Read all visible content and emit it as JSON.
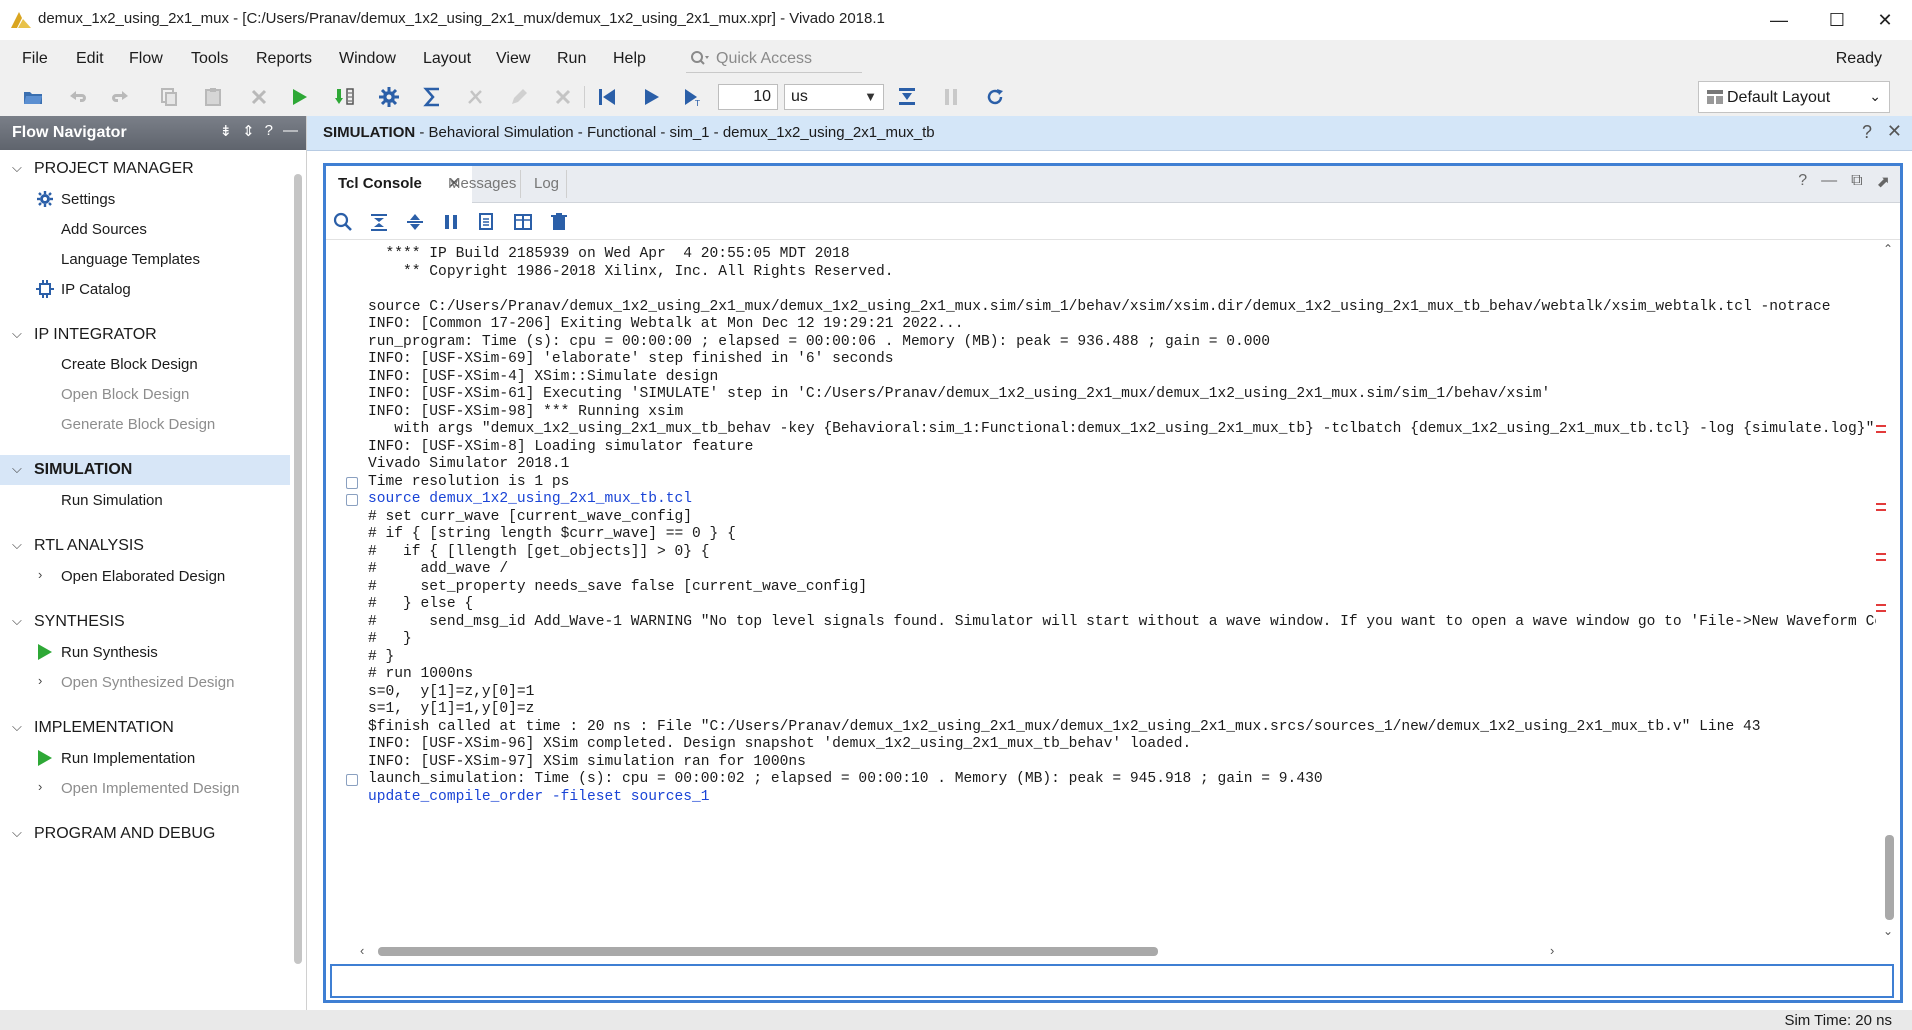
{
  "window": {
    "title": "demux_1x2_using_2x1_mux - [C:/Users/Pranav/demux_1x2_using_2x1_mux/demux_1x2_using_2x1_mux.xpr] - Vivado 2018.1",
    "minimize": "—",
    "maximize": "☐",
    "close": "✕"
  },
  "menu": {
    "items": [
      "File",
      "Edit",
      "Flow",
      "Tools",
      "Reports",
      "Window",
      "Layout",
      "View",
      "Run",
      "Help"
    ],
    "quick_access": "Quick Access",
    "status": "Ready"
  },
  "toolbar": {
    "run_time_value": "10",
    "run_time_unit": "us",
    "layout": "Default Layout",
    "icons": [
      "open-project-icon",
      "undo-icon",
      "redo-icon",
      "copy-icon",
      "paste-icon",
      "delete-icon",
      "run-icon",
      "run-all-icon",
      "settings-icon",
      "sigma-icon",
      "cut-icon",
      "edit-icon",
      "cancel-icon",
      "restart-icon",
      "run-all-sim-icon",
      "run-for-icon",
      "step-icon",
      "break-icon",
      "relaunch-icon"
    ]
  },
  "flow_navigator": {
    "title": "Flow Navigator",
    "sections": [
      {
        "label": "PROJECT MANAGER",
        "items": [
          {
            "label": "Settings",
            "icon": "gear-icon",
            "enabled": true
          },
          {
            "label": "Add Sources",
            "enabled": true
          },
          {
            "label": "Language Templates",
            "enabled": true
          },
          {
            "label": "IP Catalog",
            "icon": "ip-catalog-icon",
            "enabled": true
          }
        ]
      },
      {
        "label": "IP INTEGRATOR",
        "items": [
          {
            "label": "Create Block Design",
            "enabled": true
          },
          {
            "label": "Open Block Design",
            "enabled": false
          },
          {
            "label": "Generate Block Design",
            "enabled": false
          }
        ]
      },
      {
        "label": "SIMULATION",
        "active": true,
        "items": [
          {
            "label": "Run Simulation",
            "enabled": true
          }
        ]
      },
      {
        "label": "RTL ANALYSIS",
        "items": [
          {
            "label": "Open Elaborated Design",
            "enabled": true,
            "expandable": true
          }
        ]
      },
      {
        "label": "SYNTHESIS",
        "items": [
          {
            "label": "Run Synthesis",
            "icon": "run-icon",
            "enabled": true
          },
          {
            "label": "Open Synthesized Design",
            "enabled": false,
            "expandable": true
          }
        ]
      },
      {
        "label": "IMPLEMENTATION",
        "items": [
          {
            "label": "Run Implementation",
            "icon": "run-icon",
            "enabled": true
          },
          {
            "label": "Open Implemented Design",
            "enabled": false,
            "expandable": true
          }
        ]
      },
      {
        "label": "PROGRAM AND DEBUG",
        "items": []
      }
    ]
  },
  "sim_header": {
    "bold": "SIMULATION",
    "rest": " - Behavioral Simulation - Functional - sim_1 - demux_1x2_using_2x1_mux_tb",
    "help": "?",
    "close": "✕"
  },
  "panel": {
    "tabs": [
      "Tcl Console",
      "Messages",
      "Log"
    ],
    "active_tab": "Tcl Console",
    "tab_close": "✕"
  },
  "console": {
    "lines": [
      {
        "text": "  **** IP Build 2185939 on Wed Apr  4 20:55:05 MDT 2018",
        "style": "normal"
      },
      {
        "text": "    ** Copyright 1986-2018 Xilinx, Inc. All Rights Reserved.",
        "style": "normal"
      },
      {
        "text": "",
        "style": "normal"
      },
      {
        "text": "source C:/Users/Pranav/demux_1x2_using_2x1_mux/demux_1x2_using_2x1_mux.sim/sim_1/behav/xsim/xsim.dir/demux_1x2_using_2x1_mux_tb_behav/webtalk/xsim_webtalk.tcl -notrace",
        "style": "normal"
      },
      {
        "text": "INFO: [Common 17-206] Exiting Webtalk at Mon Dec 12 19:29:21 2022...",
        "style": "normal"
      },
      {
        "text": "run_program: Time (s): cpu = 00:00:00 ; elapsed = 00:00:06 . Memory (MB): peak = 936.488 ; gain = 0.000",
        "style": "normal"
      },
      {
        "text": "INFO: [USF-XSim-69] 'elaborate' step finished in '6' seconds",
        "style": "normal"
      },
      {
        "text": "INFO: [USF-XSim-4] XSim::Simulate design",
        "style": "normal"
      },
      {
        "text": "INFO: [USF-XSim-61] Executing 'SIMULATE' step in 'C:/Users/Pranav/demux_1x2_using_2x1_mux/demux_1x2_using_2x1_mux.sim/sim_1/behav/xsim'",
        "style": "normal"
      },
      {
        "text": "INFO: [USF-XSim-98] *** Running xsim",
        "style": "normal"
      },
      {
        "text": "   with args \"demux_1x2_using_2x1_mux_tb_behav -key {Behavioral:sim_1:Functional:demux_1x2_using_2x1_mux_tb} -tclbatch {demux_1x2_using_2x1_mux_tb.tcl} -log {simulate.log}\"",
        "style": "normal"
      },
      {
        "text": "INFO: [USF-XSim-8] Loading simulator feature",
        "style": "normal"
      },
      {
        "text": "Vivado Simulator 2018.1",
        "style": "normal"
      },
      {
        "text": "Time resolution is 1 ps",
        "style": "normal",
        "fold": true
      },
      {
        "text": "source demux_1x2_using_2x1_mux_tb.tcl",
        "style": "blue",
        "fold": true
      },
      {
        "text": "# set curr_wave [current_wave_config]",
        "style": "normal"
      },
      {
        "text": "# if { [string length $curr_wave] == 0 } {",
        "style": "normal"
      },
      {
        "text": "#   if { [llength [get_objects]] > 0} {",
        "style": "normal"
      },
      {
        "text": "#     add_wave /",
        "style": "normal"
      },
      {
        "text": "#     set_property needs_save false [current_wave_config]",
        "style": "normal"
      },
      {
        "text": "#   } else {",
        "style": "normal"
      },
      {
        "text": "#      send_msg_id Add_Wave-1 WARNING \"No top level signals found. Simulator will start without a wave window. If you want to open a wave window go to 'File->New Waveform Co",
        "style": "normal"
      },
      {
        "text": "#   }",
        "style": "normal"
      },
      {
        "text": "# }",
        "style": "normal"
      },
      {
        "text": "# run 1000ns",
        "style": "normal"
      },
      {
        "text": "s=0,  y[1]=z,y[0]=1",
        "style": "normal"
      },
      {
        "text": "s=1,  y[1]=1,y[0]=z",
        "style": "normal"
      },
      {
        "text": "$finish called at time : 20 ns : File \"C:/Users/Pranav/demux_1x2_using_2x1_mux/demux_1x2_using_2x1_mux.srcs/sources_1/new/demux_1x2_using_2x1_mux_tb.v\" Line 43",
        "style": "normal"
      },
      {
        "text": "INFO: [USF-XSim-96] XSim completed. Design snapshot 'demux_1x2_using_2x1_mux_tb_behav' loaded.",
        "style": "normal"
      },
      {
        "text": "INFO: [USF-XSim-97] XSim simulation ran for 1000ns",
        "style": "normal"
      },
      {
        "text": "launch_simulation: Time (s): cpu = 00:00:02 ; elapsed = 00:00:10 . Memory (MB): peak = 945.918 ; gain = 9.430",
        "style": "normal",
        "fold": true
      },
      {
        "text": "update_compile_order -fileset sources_1",
        "style": "blue"
      }
    ],
    "input_value": ""
  },
  "status": {
    "sim_time": "Sim Time: 20 ns"
  },
  "colors": {
    "accent": "#3f7fd3",
    "sim_header_bg": "#d4e6f8",
    "run_green": "#2ea836",
    "tcl_blue": "#1a44d6",
    "error_marker": "#e23b3b"
  }
}
